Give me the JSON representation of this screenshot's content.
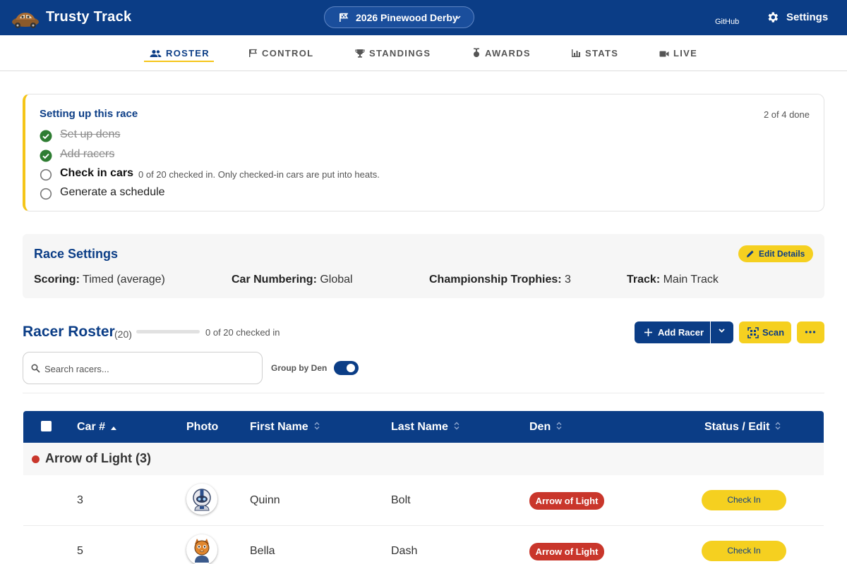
{
  "header": {
    "brand": "Trusty Track",
    "race_selector": "2026 Pinewood Derby",
    "github": "GitHub",
    "settings": "Settings"
  },
  "tabs": [
    {
      "label": "ROSTER",
      "icon": "users-icon",
      "active": true
    },
    {
      "label": "CONTROL",
      "icon": "flag-icon"
    },
    {
      "label": "STANDINGS",
      "icon": "trophy-icon"
    },
    {
      "label": "AWARDS",
      "icon": "medal-icon"
    },
    {
      "label": "STATS",
      "icon": "bar-chart-icon"
    },
    {
      "label": "LIVE",
      "icon": "video-camera-icon"
    }
  ],
  "setup": {
    "title": "Setting up this race",
    "progress": "2 of 4 done",
    "steps": [
      {
        "label": "Set up dens",
        "status": "done"
      },
      {
        "label": "Add racers",
        "status": "done"
      },
      {
        "label": "Check in cars",
        "status": "current",
        "note": "0 of 20 checked in. Only checked-in cars are put into heats."
      },
      {
        "label": "Generate a schedule",
        "status": "todo"
      }
    ]
  },
  "race_settings": {
    "title": "Race Settings",
    "edit_label": "Edit Details",
    "items": [
      {
        "label": "Scoring:",
        "value": "Timed (average)"
      },
      {
        "label": "Car Numbering:",
        "value": "Global"
      },
      {
        "label": "Championship Trophies:",
        "value": "3"
      },
      {
        "label": "Track:",
        "value": "Main Track"
      }
    ]
  },
  "roster": {
    "title": "Racer Roster",
    "count": "(20)",
    "checked_in_fraction": 0,
    "checked_in_text": "0 of 20 checked in",
    "add_racer": "Add Racer",
    "scan": "Scan",
    "search_placeholder": "Search racers...",
    "group_by_den": "Group by Den",
    "group_by_den_on": true
  },
  "table": {
    "columns": [
      "Car #",
      "Photo",
      "First Name",
      "Last Name",
      "Den",
      "Status / Edit"
    ],
    "groups": [
      {
        "name": "Arrow of Light (3)",
        "color": "#c9362b",
        "rows": [
          {
            "car": "3",
            "photo": "astronaut-avatar",
            "first": "Quinn",
            "last": "Bolt",
            "den": "Arrow of Light",
            "action": "Check In"
          },
          {
            "car": "5",
            "photo": "tiger-avatar",
            "first": "Bella",
            "last": "Dash",
            "den": "Arrow of Light",
            "action": "Check In"
          }
        ]
      }
    ]
  },
  "colors": {
    "primary": "#0b3d86",
    "accent": "#f5d020",
    "success": "#2e7d32",
    "den_arrow_of_light": "#c9362b"
  }
}
